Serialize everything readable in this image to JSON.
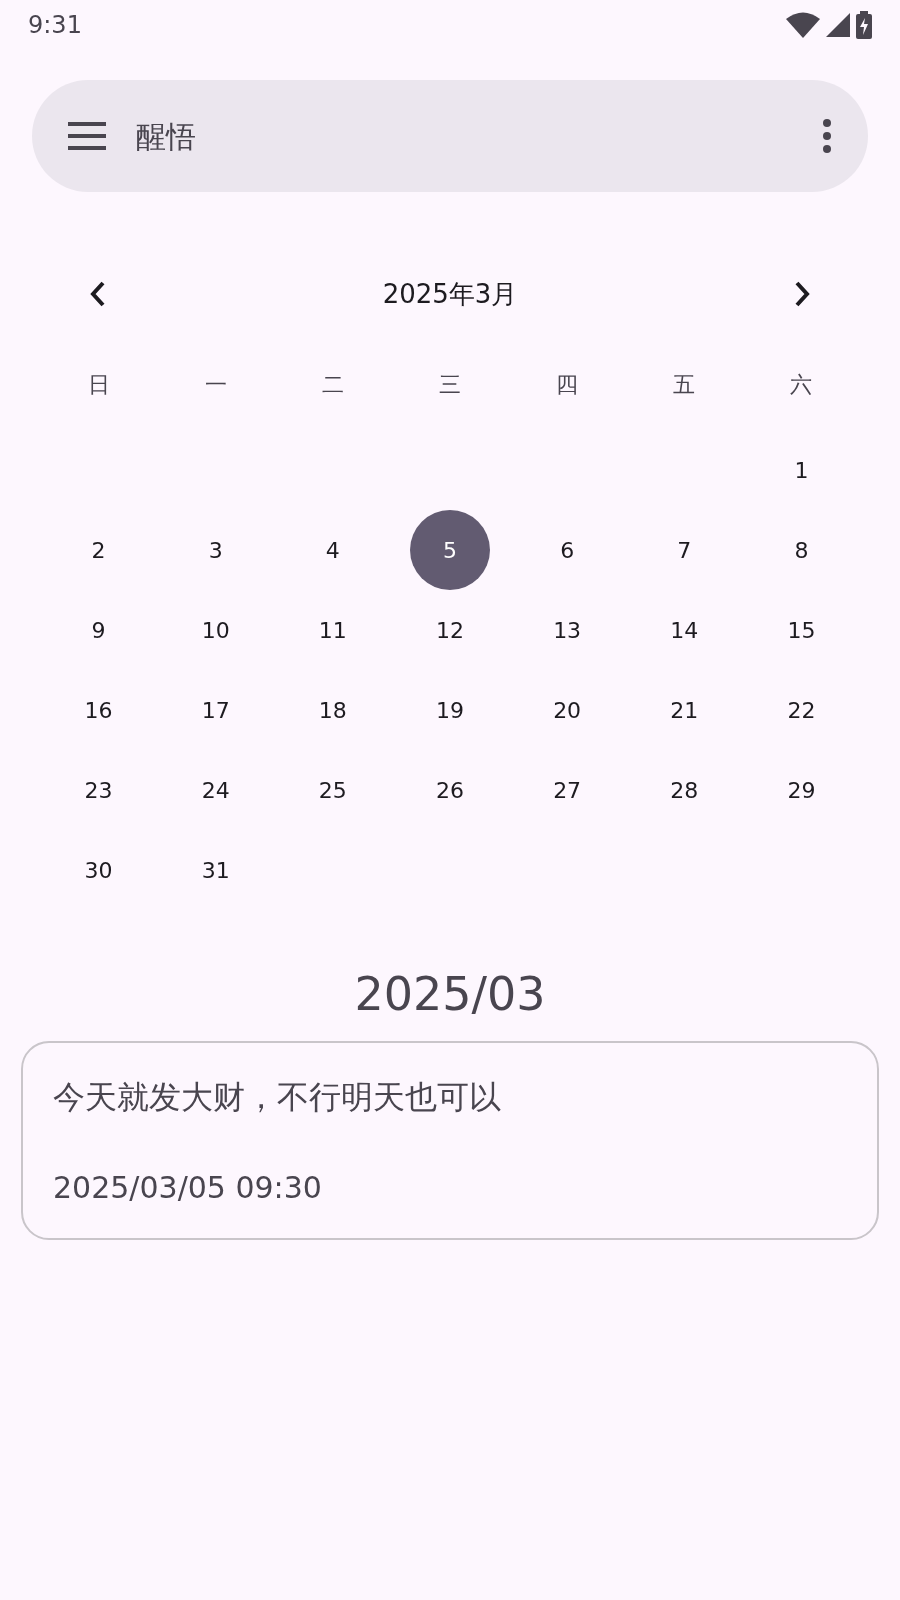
{
  "status_bar": {
    "time": "9:31"
  },
  "app_bar": {
    "title": "醒悟"
  },
  "calendar": {
    "month_label": "2025年3月",
    "weekdays": [
      "日",
      "一",
      "二",
      "三",
      "四",
      "五",
      "六"
    ],
    "weeks": [
      [
        {
          "day": "1",
          "selected": false
        }
      ],
      [
        {
          "day": "2",
          "selected": false
        },
        {
          "day": "3",
          "selected": false
        },
        {
          "day": "4",
          "selected": false
        },
        {
          "day": "5",
          "selected": true
        },
        {
          "day": "6",
          "selected": false
        },
        {
          "day": "7",
          "selected": false
        },
        {
          "day": "8",
          "selected": false
        }
      ],
      [
        {
          "day": "9",
          "selected": false
        },
        {
          "day": "10",
          "selected": false
        },
        {
          "day": "11",
          "selected": false
        },
        {
          "day": "12",
          "selected": false
        },
        {
          "day": "13",
          "selected": false
        },
        {
          "day": "14",
          "selected": false
        },
        {
          "day": "15",
          "selected": false
        }
      ],
      [
        {
          "day": "16",
          "selected": false
        },
        {
          "day": "17",
          "selected": false
        },
        {
          "day": "18",
          "selected": false
        },
        {
          "day": "19",
          "selected": false
        },
        {
          "day": "20",
          "selected": false
        },
        {
          "day": "21",
          "selected": false
        },
        {
          "day": "22",
          "selected": false
        }
      ],
      [
        {
          "day": "23",
          "selected": false
        },
        {
          "day": "24",
          "selected": false
        },
        {
          "day": "25",
          "selected": false
        },
        {
          "day": "26",
          "selected": false
        },
        {
          "day": "27",
          "selected": false
        },
        {
          "day": "28",
          "selected": false
        },
        {
          "day": "29",
          "selected": false
        }
      ],
      [
        {
          "day": "30",
          "selected": false
        },
        {
          "day": "31",
          "selected": false
        }
      ]
    ]
  },
  "section_heading": "2025/03",
  "entries": [
    {
      "text": "今天就发大财，不行明天也可以",
      "timestamp": "2025/03/05 09:30"
    }
  ]
}
